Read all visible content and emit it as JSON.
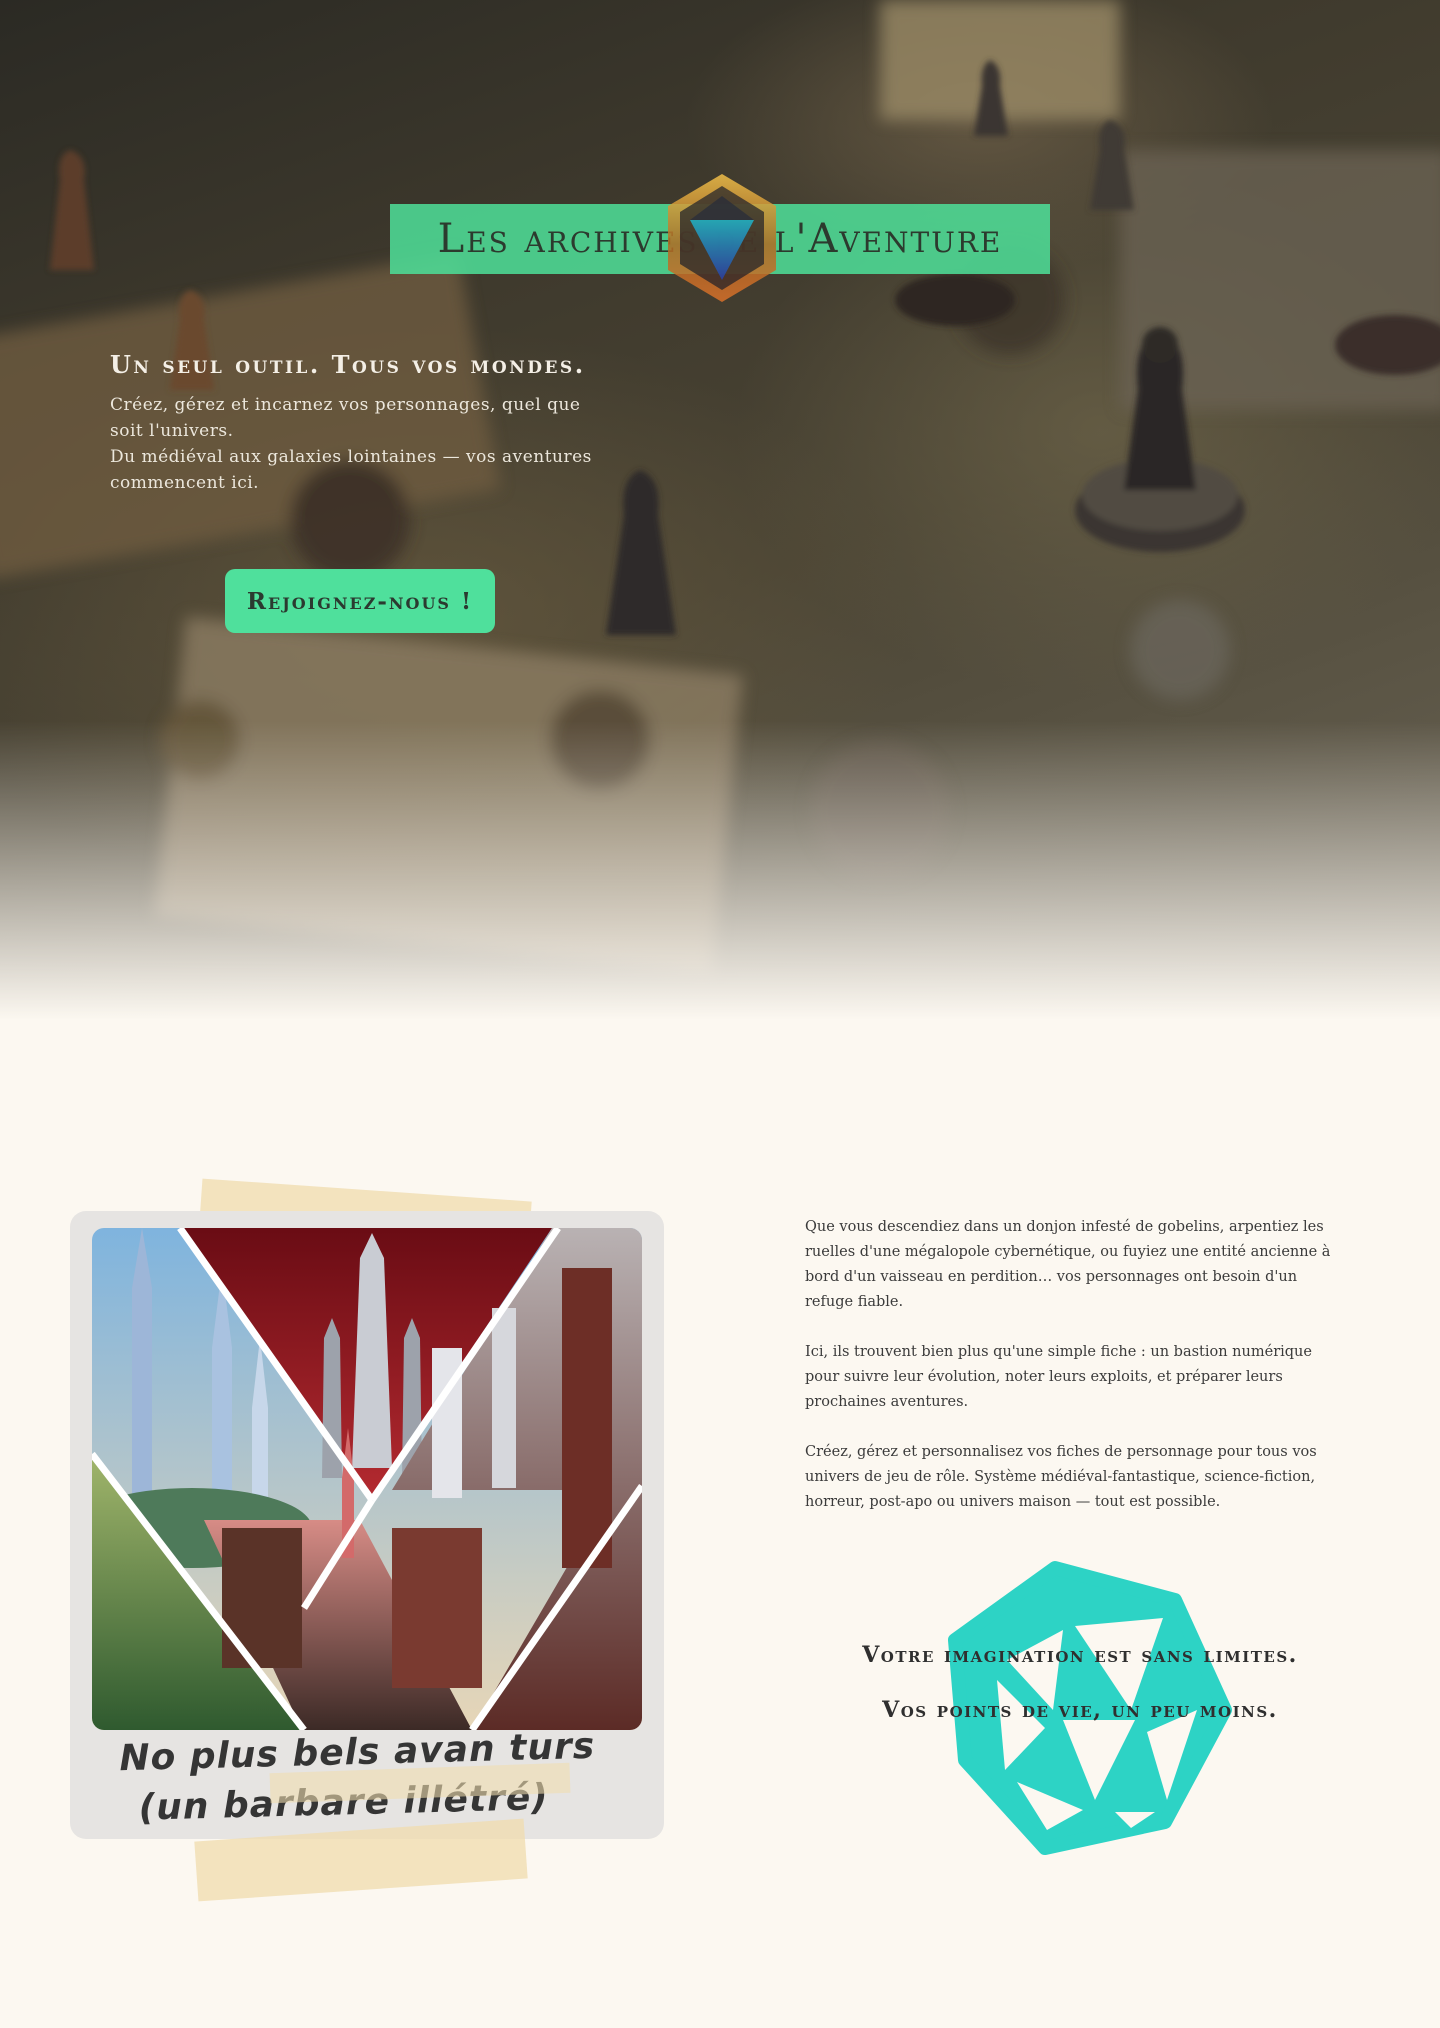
{
  "hero": {
    "title": "Les archives de l'Aventure",
    "emblem_icon": "d20-emblem-icon",
    "tagline": "Un seul outil. Tous vos mondes.",
    "description_line1": "Créez, gérez et incarnez vos personnages, quel que soit l'univers.",
    "description_line2": "Du médiéval aux galaxies lointaines — vos aventures commencent ici.",
    "cta_label": "Rejoignez-nous !"
  },
  "polaroid": {
    "photo_alt": "collage of fantasy, sci-fi and steampunk cities",
    "caption_line1": "No plus bels avan turs",
    "caption_line2": "(un barbare illétré)"
  },
  "story": {
    "paragraph1": "Que vous descendiez dans un donjon infesté de gobelins, arpentiez les ruelles d'une mégalopole cybernétique, ou fuyiez une entité ancienne à bord d'un vaisseau en perdition… vos personnages ont besoin d'un refuge fiable.",
    "paragraph2": "Ici, ils trouvent bien plus qu'une simple fiche : un bastion numérique pour suivre leur évolution, noter leurs exploits, et préparer leurs prochaines aventures.",
    "paragraph3": "Créez, gérez et personnalisez vos fiches de personnage pour tous vos univers de jeu de rôle. Système médiéval-fantastique, science-fiction, horreur, post-apo ou univers maison — tout est possible."
  },
  "motto": {
    "line1": "Votre imagination est sans limites.",
    "line2": "Vos points de vie, un peu moins."
  },
  "colors": {
    "accent": "#4fe09c",
    "dice": "#2dd3c5",
    "background": "#fcf8f1",
    "tape": "#f0ddaf"
  }
}
